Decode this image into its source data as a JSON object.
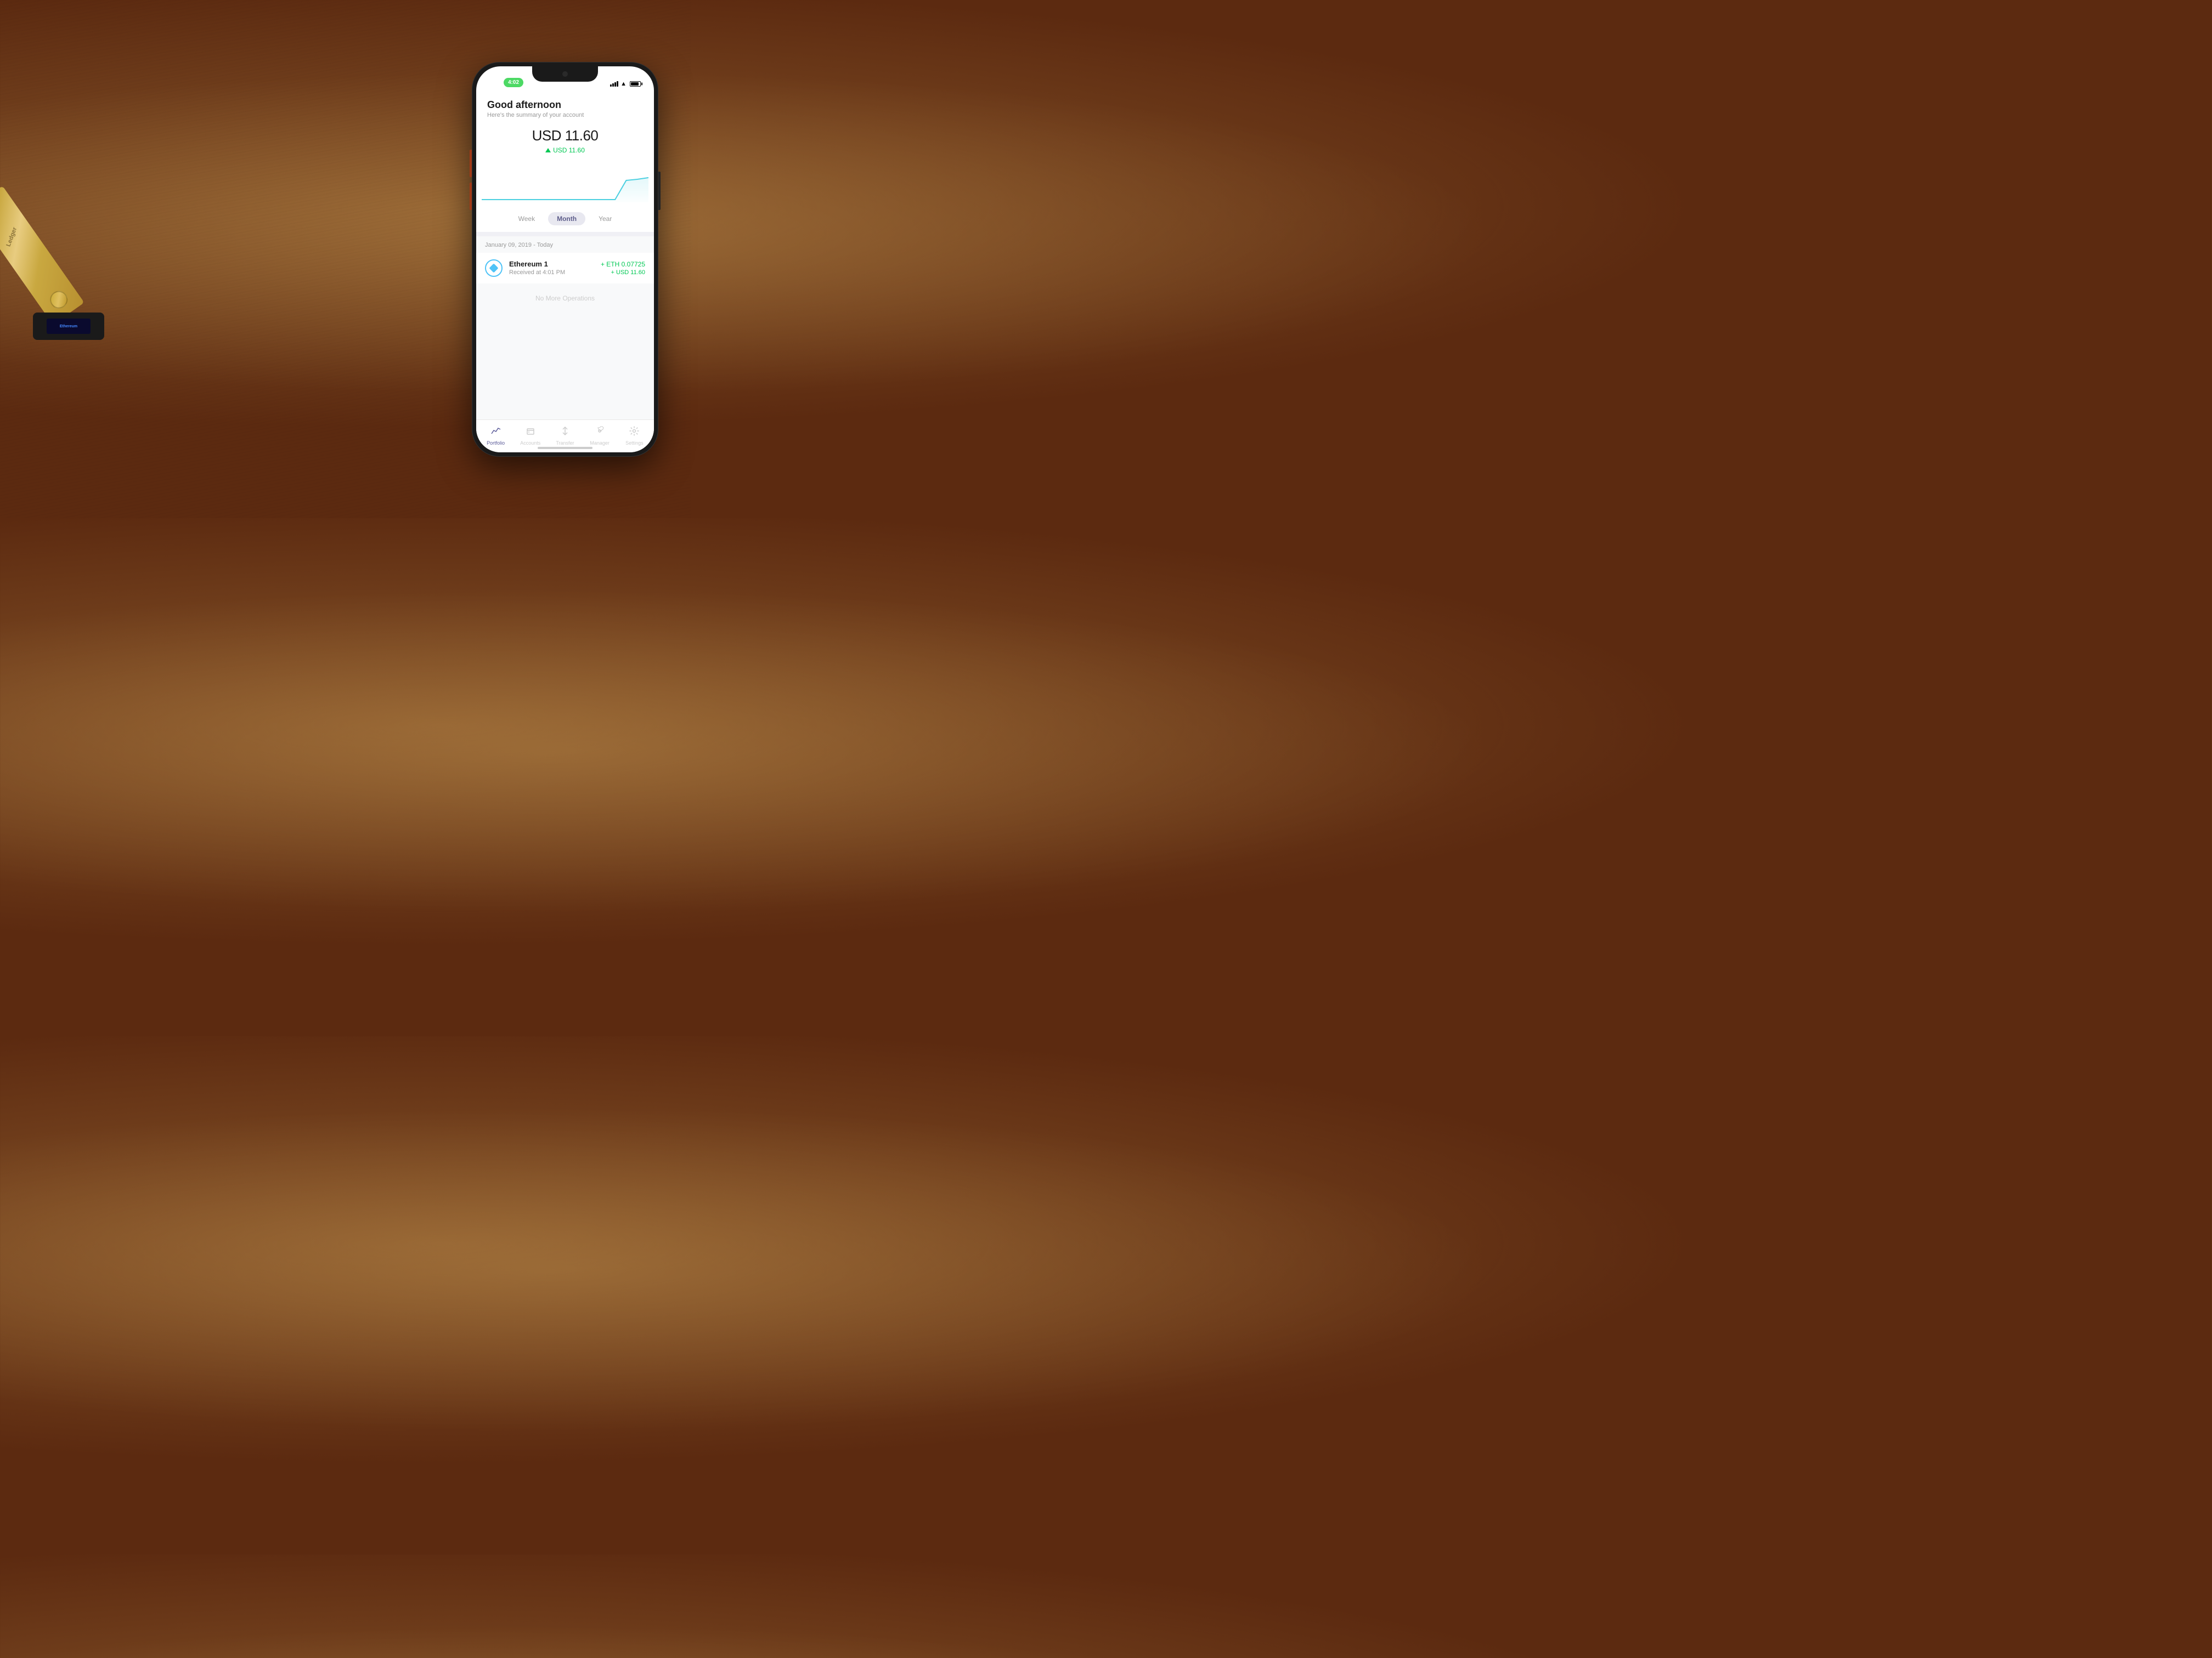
{
  "phone": {
    "status_bar": {
      "time": "4:02",
      "battery_label": "battery"
    },
    "greeting": {
      "title": "Good afternoon",
      "subtitle": "Here's the summary of your account"
    },
    "balance": {
      "amount": "USD 11.60",
      "change": "USD 11.60"
    },
    "chart": {
      "label": "portfolio chart"
    },
    "time_range": {
      "options": [
        "Week",
        "Month",
        "Year"
      ],
      "active": "Month"
    },
    "date_range": {
      "label": "January 09, 2019 - Today"
    },
    "transaction": {
      "name": "Ethereum 1",
      "time": "Received at 4:01 PM",
      "eth_amount": "+ ETH 0.07725",
      "usd_amount": "+ USD 11.60"
    },
    "no_more": "No More Operations",
    "nav": {
      "items": [
        {
          "label": "Portfolio",
          "active": true,
          "icon": "📈"
        },
        {
          "label": "Accounts",
          "active": false,
          "icon": "💼"
        },
        {
          "label": "Transfer",
          "active": false,
          "icon": "↕"
        },
        {
          "label": "Manager",
          "active": false,
          "icon": "⚙"
        },
        {
          "label": "Settings",
          "active": false,
          "icon": "⚙"
        }
      ]
    }
  },
  "colors": {
    "accent": "#5c5c9a",
    "positive": "#00c853",
    "chart_line": "#4dd0e1",
    "eth_icon": "#4fc3f7"
  }
}
